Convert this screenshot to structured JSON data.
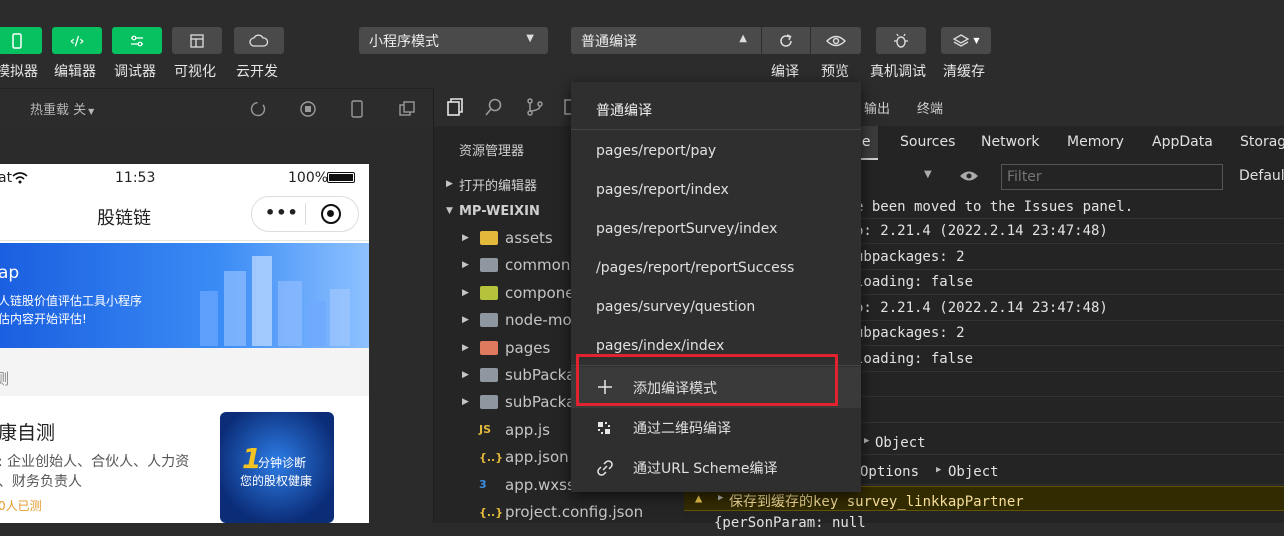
{
  "toolbar": {
    "buttons": [
      {
        "label": "模拟器",
        "icon": "phone-icon"
      },
      {
        "label": "编辑器",
        "icon": "code-icon"
      },
      {
        "label": "调试器",
        "icon": "sliders-icon"
      },
      {
        "label": "可视化",
        "icon": "layout-icon"
      },
      {
        "label": "云开发",
        "icon": "cloud-icon"
      }
    ],
    "mode_select": "小程序模式",
    "compile_select": "普通编译",
    "right_buttons": [
      {
        "label": "编译",
        "icon": "refresh-icon"
      },
      {
        "label": "预览",
        "icon": "eye-icon"
      },
      {
        "label": "真机调试",
        "icon": "bug-icon"
      },
      {
        "label": "清缓存",
        "icon": "layers-icon"
      }
    ]
  },
  "simulator_bar": {
    "hot_reload": "热重载 关"
  },
  "phone": {
    "carrier": "at",
    "time": "11:53",
    "battery": "100%",
    "nav_title": "股链链",
    "banner_title": "ap",
    "banner_line1": "人链股价值评估工具小程序",
    "banner_line2": "估内容开始评估!",
    "section_label": "测",
    "card_title": "康自测",
    "card_desc1": ": 企业创始人、合伙人、人力资",
    "card_desc2": "、财务负责人",
    "card_count": "0人已测",
    "card_img_line1": "分钟诊断",
    "card_img_line2": "您的股权健康",
    "card_img_num": "1"
  },
  "explorer": {
    "title": "资源管理器",
    "open_editors": "打开的编辑器",
    "project": "MP-WEIXIN",
    "items": [
      {
        "name": "assets",
        "type": "folder",
        "color": "#e2b93b"
      },
      {
        "name": "common",
        "type": "folder",
        "color": "#8e96a0"
      },
      {
        "name": "compone",
        "type": "folder",
        "color": "#b5c33c"
      },
      {
        "name": "node-mo",
        "type": "folder",
        "color": "#8e96a0"
      },
      {
        "name": "pages",
        "type": "folder",
        "color": "#e07a5f"
      },
      {
        "name": "subPacka",
        "type": "folder",
        "color": "#8e96a0"
      },
      {
        "name": "subPacka",
        "type": "folder",
        "color": "#8e96a0"
      },
      {
        "name": "app.js",
        "type": "file",
        "badge": "JS",
        "color": "#e2b93b"
      },
      {
        "name": "app.json",
        "type": "file",
        "badge": "{..}",
        "color": "#e2b93b"
      },
      {
        "name": "app.wxss",
        "type": "file",
        "badge": "3",
        "color": "#3b8ee2"
      },
      {
        "name": "project.config.json",
        "type": "file",
        "badge": "{..}",
        "color": "#e2b93b"
      }
    ]
  },
  "devtools": {
    "top_tabs": [
      "输出",
      "终端"
    ],
    "tabs": [
      "le",
      "Sources",
      "Network",
      "Memory",
      "AppData",
      "Storag"
    ],
    "filter_placeholder": "Filter",
    "default_levels": "Default",
    "console_lines": [
      "e been moved to the Issues panel.",
      "o: 2.21.4 (2022.2.14 23:47:48)",
      "ubpackages: 2",
      "loading: false",
      "o: 2.21.4 (2022.2.14 23:47:48)",
      "ubpackages: 2",
      "loading: false",
      "",
      "",
      "Object",
      "Options",
      "Object",
      "保存到缓存的key survey_linkkapPartner",
      "{perSonParam: null"
    ]
  },
  "dropdown": {
    "header": "普通编译",
    "items": [
      "pages/report/pay",
      "pages/report/index",
      "pages/reportSurvey/index",
      "/pages/report/reportSuccess",
      "pages/survey/question",
      "pages/index/index"
    ],
    "actions": [
      {
        "label": "添加编译模式",
        "icon": "plus-icon"
      },
      {
        "label": "通过二维码编译",
        "icon": "qrcode-icon"
      },
      {
        "label": "通过URL Scheme编译",
        "icon": "link-icon"
      }
    ],
    "highlight_color": "#e0232f"
  }
}
